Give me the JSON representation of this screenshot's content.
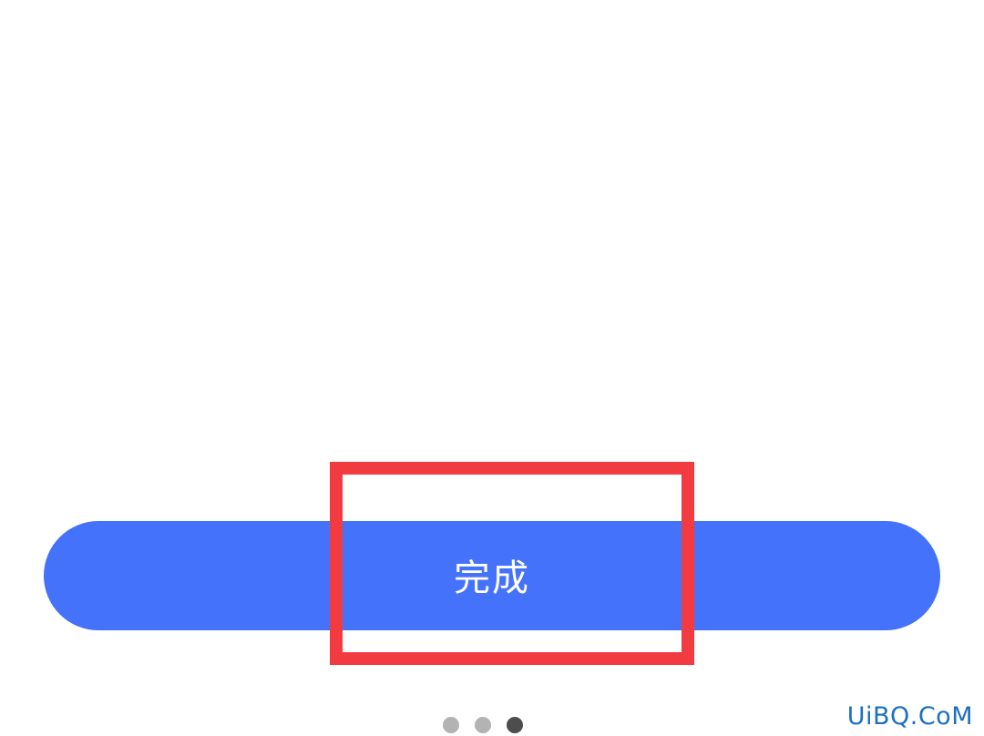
{
  "done_button": {
    "label": "完成",
    "background": "#4572fb",
    "text_color": "#ffffff"
  },
  "highlight": {
    "color": "#f23a41"
  },
  "pager": {
    "count": 3,
    "active_index": 2
  },
  "watermark": {
    "text": "UiBQ.CoM"
  }
}
